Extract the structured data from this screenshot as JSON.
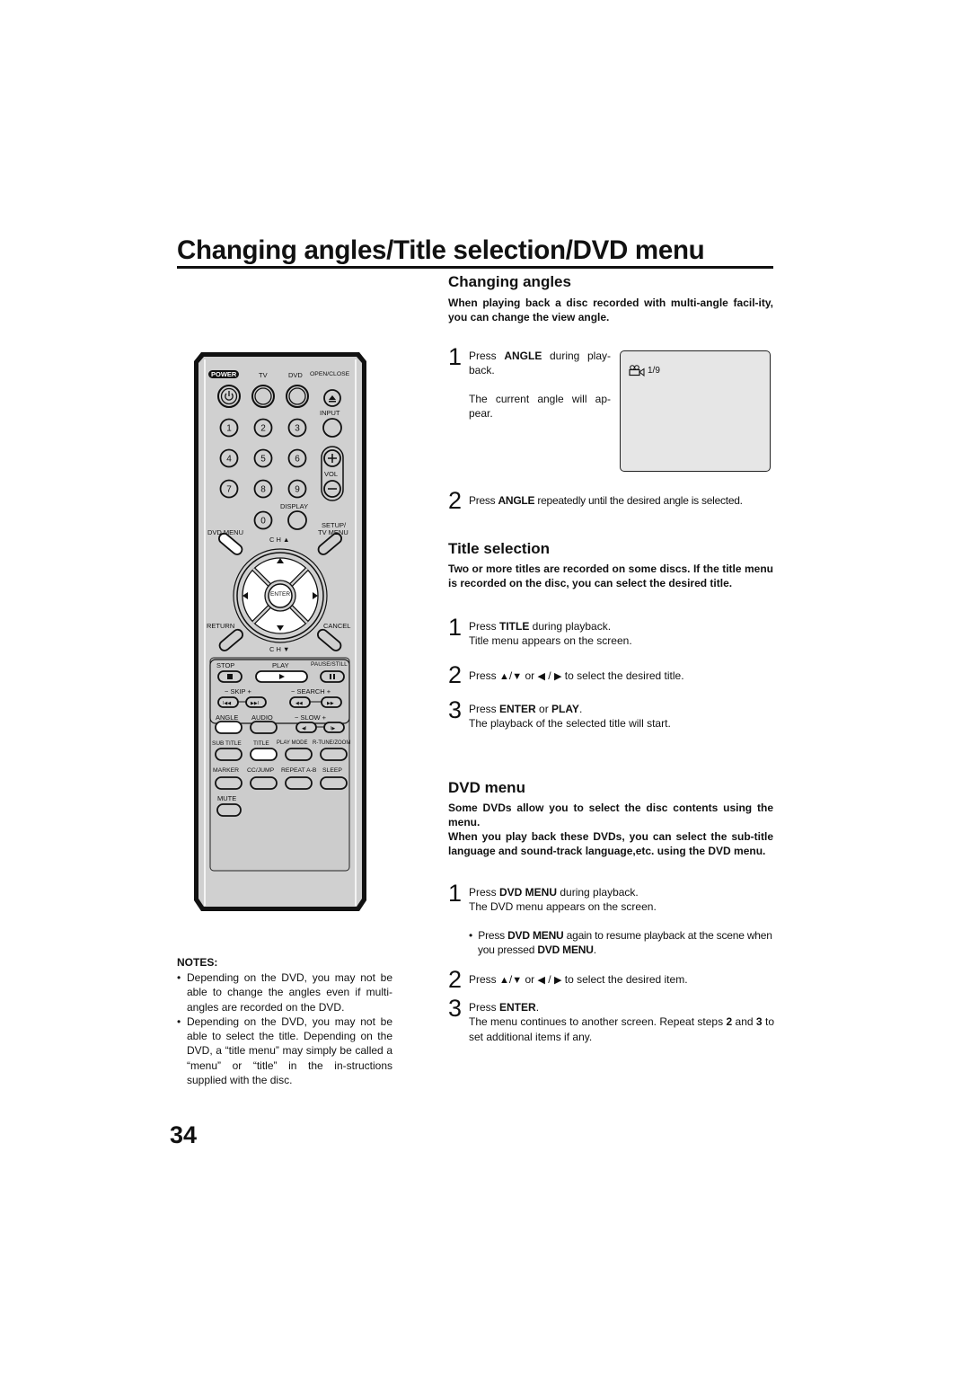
{
  "page": {
    "title": "Changing angles/Title selection/DVD menu",
    "page_number": "34"
  },
  "changing_angles": {
    "heading": "Changing angles",
    "lead": "When playing back a disc recorded with multi-angle facil-ity, you can change the view angle.",
    "step1": {
      "num": "1",
      "pre": "Press ",
      "key": "ANGLE",
      "post": " during play-back.",
      "note": "The current angle will ap-pear."
    },
    "screen": {
      "icon": "camera-angle-icon",
      "value": "1/9"
    },
    "step2": {
      "num": "2",
      "pre": "Press ",
      "key": "ANGLE",
      "post": " repeatedly until the desired angle is selected."
    }
  },
  "title_selection": {
    "heading": "Title selection",
    "lead": "Two or more titles are recorded on some discs. If the title menu is recorded on the disc, you can select the desired title.",
    "step1": {
      "num": "1",
      "pre": "Press ",
      "key": "TITLE",
      "post": " during playback.",
      "note": "Title menu appears on the screen."
    },
    "step2": {
      "num": "2",
      "pre": "Press ",
      "mid": " or ",
      "post": " to select the desired title."
    },
    "step3": {
      "num": "3",
      "pre": "Press ",
      "key1": "ENTER",
      "or": " or ",
      "key2": "PLAY",
      "post": ".",
      "note": "The playback of the selected title will start."
    }
  },
  "dvd_menu": {
    "heading": "DVD menu",
    "lead1": "Some DVDs allow you to select the disc contents using the menu.",
    "lead2": "When you play back these DVDs, you can select the sub-title language and sound-track language,etc. using the DVD menu.",
    "step1": {
      "num": "1",
      "pre": "Press ",
      "key": "DVD MENU",
      "post": " during playback.",
      "note": "The DVD menu appears on the screen."
    },
    "bullet": {
      "pre": "Press ",
      "key1": "DVD MENU",
      "mid": " again to resume playback at the scene when you pressed ",
      "key2": "DVD MENU",
      "post": "."
    },
    "step2": {
      "num": "2",
      "pre": "Press ",
      "mid": " or ",
      "post": " to select the desired item."
    },
    "step3": {
      "num": "3",
      "pre": "Press ",
      "key": "ENTER",
      "post": ".",
      "note_a": "The menu continues to another screen. Repeat steps ",
      "note_b": "2",
      "note_c": " and ",
      "note_d": "3",
      "note_e": " to set additional items if any."
    }
  },
  "arrows": {
    "up": "▲",
    "down": "▼",
    "left": "◀",
    "right": "▶",
    "slash": "/"
  },
  "notes": {
    "heading": "NOTES:",
    "items": [
      "Depending on the DVD, you may not be able to change the angles even if multi-angles are recorded on the DVD.",
      "Depending on the DVD, you may not be able to select the title. Depending on the DVD, a “title menu” may simply be called a “menu” or “title” in the in-structions supplied with the disc."
    ]
  },
  "remote": {
    "labels": {
      "power": "POWER",
      "tv": "TV",
      "dvd": "DVD",
      "open_close": "OPEN/CLOSE",
      "input": "INPUT",
      "vol": "VOL",
      "display": "DISPLAY",
      "setup": "SETUP/",
      "tv_menu": "TV MENU",
      "dvd_menu": "DVD MENU",
      "ch_up": "C H ▲",
      "ch_down": "C H ▼",
      "enter": "ENTER",
      "return": "RETURN",
      "cancel": "CANCEL",
      "stop": "STOP",
      "play": "PLAY",
      "pause_still": "PAUSE/STILL",
      "skip": "−  SKIP  +",
      "search": "−  SEARCH +",
      "slow": "− SLOW +",
      "angle": "ANGLE",
      "audio": "AUDIO",
      "sub_title": "SUB TITLE",
      "title": "TITLE",
      "play_mode": "PLAY MODE",
      "rtune_zoom": "R-TUNE/ZOOM",
      "marker": "MARKER",
      "cc_jump": "CC/JUMP",
      "repeat_ab": "REPEAT A-B",
      "sleep": "SLEEP",
      "mute": "MUTE"
    },
    "digits": [
      "1",
      "2",
      "3",
      "4",
      "5",
      "6",
      "7",
      "8",
      "9",
      "0"
    ],
    "highlighted_buttons": [
      "angle",
      "title",
      "dvd_menu",
      "play",
      "enter"
    ]
  }
}
